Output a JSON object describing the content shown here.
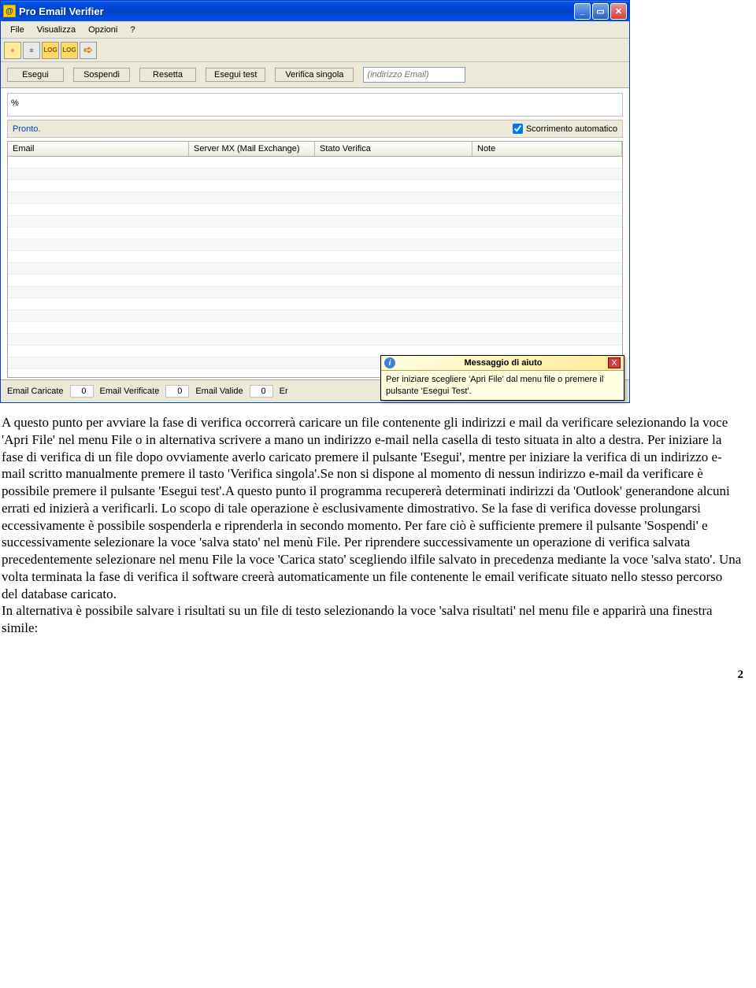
{
  "window": {
    "title": "Pro Email Verifier",
    "icon_glyph": "@"
  },
  "menu": {
    "file": "File",
    "visualizza": "Visualizza",
    "opzioni": "Opzioni",
    "help": "?"
  },
  "toolbar_icons": {
    "add": "+",
    "list": "≡",
    "log1": "LOG",
    "log2": "LOG",
    "arrow": "➪"
  },
  "actions": {
    "esegui": "Esegui",
    "sospendi": "Sospendi",
    "resetta": "Resetta",
    "esegui_test": "Esegui test",
    "verifica_singola": "Verifica singola",
    "email_placeholder": "(indirizzo Email)"
  },
  "progress": {
    "percent_label": "%"
  },
  "status": {
    "text": "Pronto.",
    "autoscroll_label": "Scorrimento automatico"
  },
  "table": {
    "col_email": "Email",
    "col_server": "Server MX (Mail Exchange)",
    "col_stato": "Stato Verifica",
    "col_note": "Note"
  },
  "stats": {
    "caricate_label": "Email Caricate",
    "caricate_val": "0",
    "verificate_label": "Email Verificate",
    "verificate_val": "0",
    "valide_label": "Email Valide",
    "valide_val": "0",
    "err_prefix": "Er"
  },
  "tooltip": {
    "title": "Messaggio di aiuto",
    "body": "Per iniziare scegliere 'Apri File' dal menu file o premere il pulsante 'Esegui Test'.",
    "close": "X",
    "info": "i"
  },
  "doc": {
    "p1": "A questo punto per avviare la fase di verifica occorrerà caricare un file contenente gli indirizzi e mail da verificare selezionando la voce 'Apri File' nel menu File o in alternativa scrivere a mano un indirizzo e-mail nella casella di testo situata in alto a destra. Per iniziare la fase di verifica di un file dopo ovviamente averlo caricato premere il pulsante 'Esegui', mentre per iniziare la verifica di un indirizzo e-mail scritto manualmente premere il tasto 'Verifica singola'.Se non si dispone al momento di nessun indirizzo e-mail da verificare è possibile premere il pulsante 'Esegui test'.A questo punto il programma recupererà determinati indirizzi da 'Outlook' generandone alcuni errati ed inizierà a verificarli. Lo scopo di tale operazione è esclusivamente dimostrativo. Se la fase di verifica dovesse prolungarsi eccessivamente è possibile sospenderla e riprenderla in secondo momento. Per fare ciò è sufficiente premere il pulsante 'Sospendi' e successivamente selezionare la voce 'salva stato' nel menù File. Per riprendere successivamente un operazione di verifica salvata precedentemente selezionare nel menu File la voce 'Carica stato' scegliendo ilfile salvato in precedenza mediante la voce 'salva stato'. Una volta terminata la fase di verifica il software creerà automaticamente un file contenente le email verificate situato nello stesso percorso del database caricato.",
    "p2": "In alternativa è possibile salvare i risultati su un file di testo selezionando la voce 'salva risultati' nel menu file e apparirà una finestra simile:"
  },
  "page_number": "2"
}
